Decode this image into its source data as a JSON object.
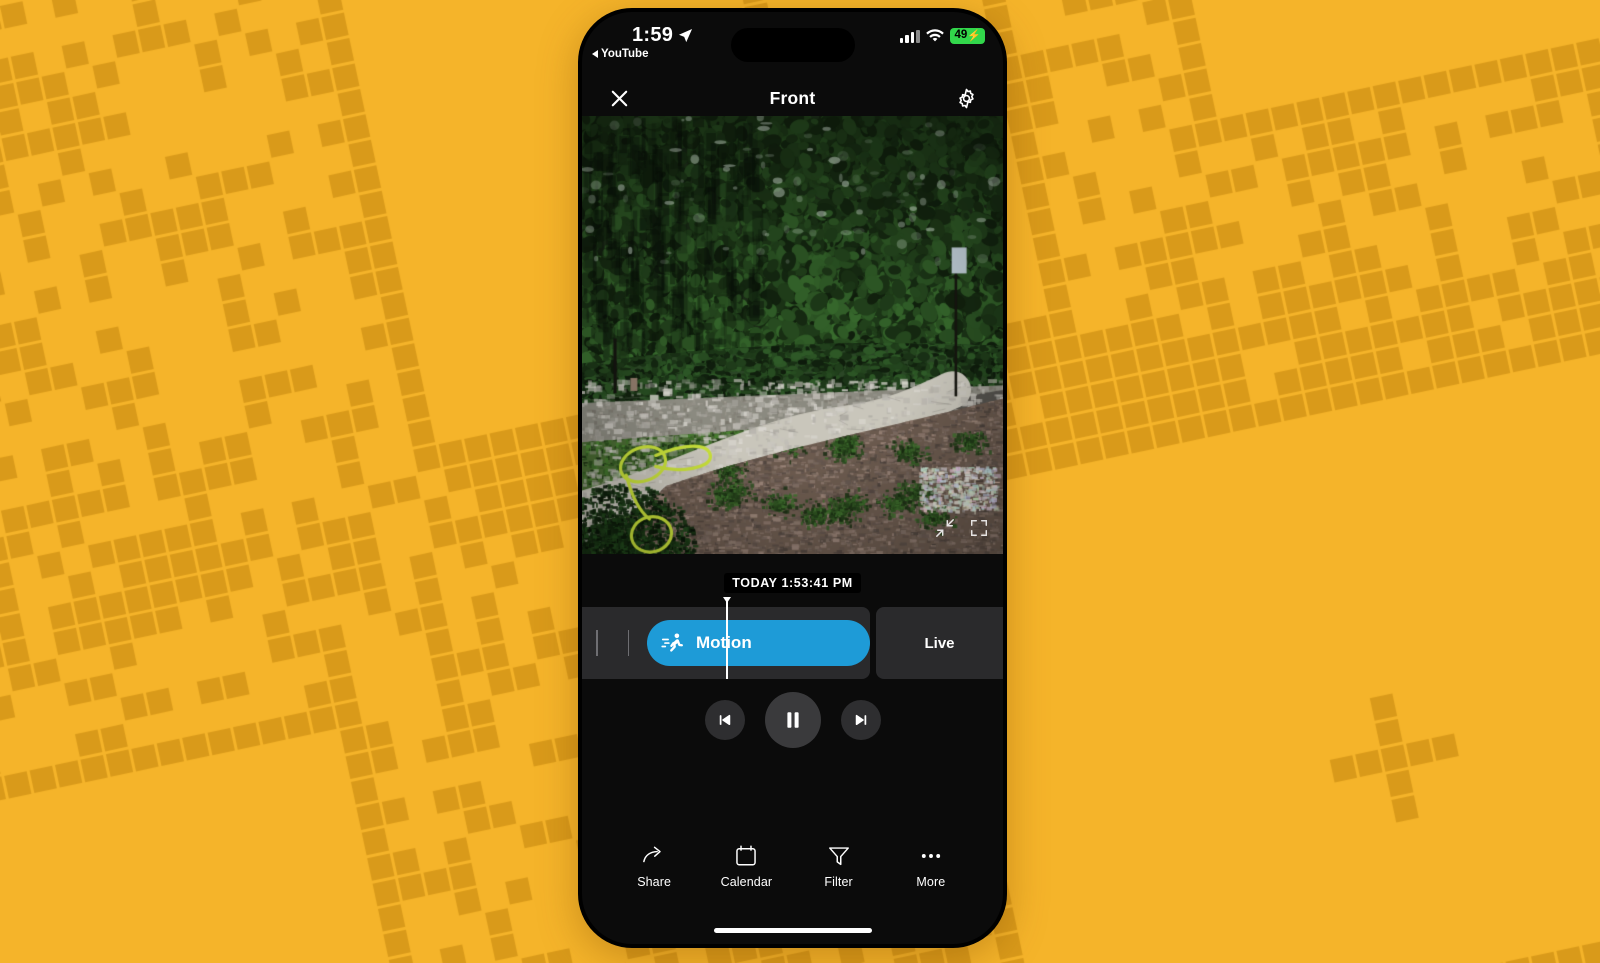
{
  "background": {
    "name": "qr-pixel-pattern",
    "base_color": "#F5B42A",
    "pixel_color": "#D99A1A",
    "rotation_deg": -12
  },
  "status_bar": {
    "time": "1:59",
    "back_app_label": "YouTube",
    "location_icon": "location-arrow-icon",
    "cellular_icon": "signal-bars-icon",
    "wifi_icon": "wifi-icon",
    "battery_level": "49",
    "battery_charging_glyph": "⚡",
    "battery_color": "#32d74b"
  },
  "nav_bar": {
    "close_icon": "close-icon",
    "title": "Front",
    "settings_icon": "gear-icon"
  },
  "video": {
    "alt": "front-yard-security-camera-view",
    "overlay_icons": [
      "shrink-arrows-icon",
      "expand-frame-icon"
    ]
  },
  "timeline": {
    "timestamp_label": "TODAY 1:53:41 PM",
    "motion_chip_label": "Motion",
    "motion_chip_icon": "running-person-icon",
    "motion_chip_color": "#1E9BD7",
    "live_label": "Live",
    "playhead_position_pct": 50
  },
  "playback": {
    "previous_icon": "skip-previous-icon",
    "pause_icon": "pause-icon",
    "next_icon": "skip-next-icon"
  },
  "bottom_bar": {
    "items": [
      {
        "label": "Share",
        "icon": "share-arrow-icon"
      },
      {
        "label": "Calendar",
        "icon": "calendar-icon"
      },
      {
        "label": "Filter",
        "icon": "funnel-icon"
      },
      {
        "label": "More",
        "icon": "ellipsis-icon"
      }
    ]
  }
}
